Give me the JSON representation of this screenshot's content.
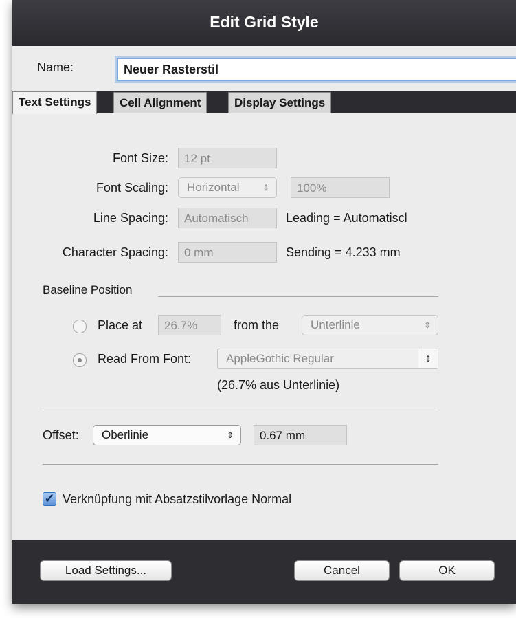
{
  "dialog": {
    "title": "Edit Grid Style"
  },
  "name_field": {
    "label": "Name:",
    "value": "Neuer Rasterstil"
  },
  "tabs": [
    {
      "label": "Text Settings",
      "active": true
    },
    {
      "label": "Cell Alignment",
      "active": false
    },
    {
      "label": "Display Settings",
      "active": false
    }
  ],
  "text_settings": {
    "font_size": {
      "label": "Font Size:",
      "value": "12 pt"
    },
    "font_scaling": {
      "label": "Font Scaling:",
      "mode": "Horizontal",
      "value": "100%"
    },
    "line_spacing": {
      "label": "Line Spacing:",
      "value": "Automatisch",
      "info": "Leading = Automatiscl"
    },
    "character_spacing": {
      "label": "Character Spacing:",
      "value": "0 mm",
      "info": "Sending = 4.233 mm"
    },
    "baseline_position": {
      "heading": "Baseline Position",
      "place_at": {
        "label": "Place at",
        "value": "26.7%",
        "from_label": "from the",
        "from_value": "Unterlinie",
        "selected": false
      },
      "read_from_font": {
        "label": "Read From Font:",
        "font": "AppleGothic Regular",
        "note": "(26.7% aus Unterlinie)",
        "selected": true
      }
    },
    "offset": {
      "label": "Offset:",
      "mode": "Oberlinie",
      "value": "0.67 mm"
    },
    "link": {
      "label": "Verknüpfung mit Absatzstilvorlage Normal",
      "checked": true
    }
  },
  "buttons": {
    "load": "Load Settings...",
    "cancel": "Cancel",
    "ok": "OK"
  },
  "icons": {
    "popup_arrows": "⇕",
    "radio_dot": "•",
    "checkmark": "✓"
  },
  "colors": {
    "titlebar": "#2a2a2f",
    "accent_focus": "#7aa9e6",
    "dialog_bg": "#ececec"
  }
}
